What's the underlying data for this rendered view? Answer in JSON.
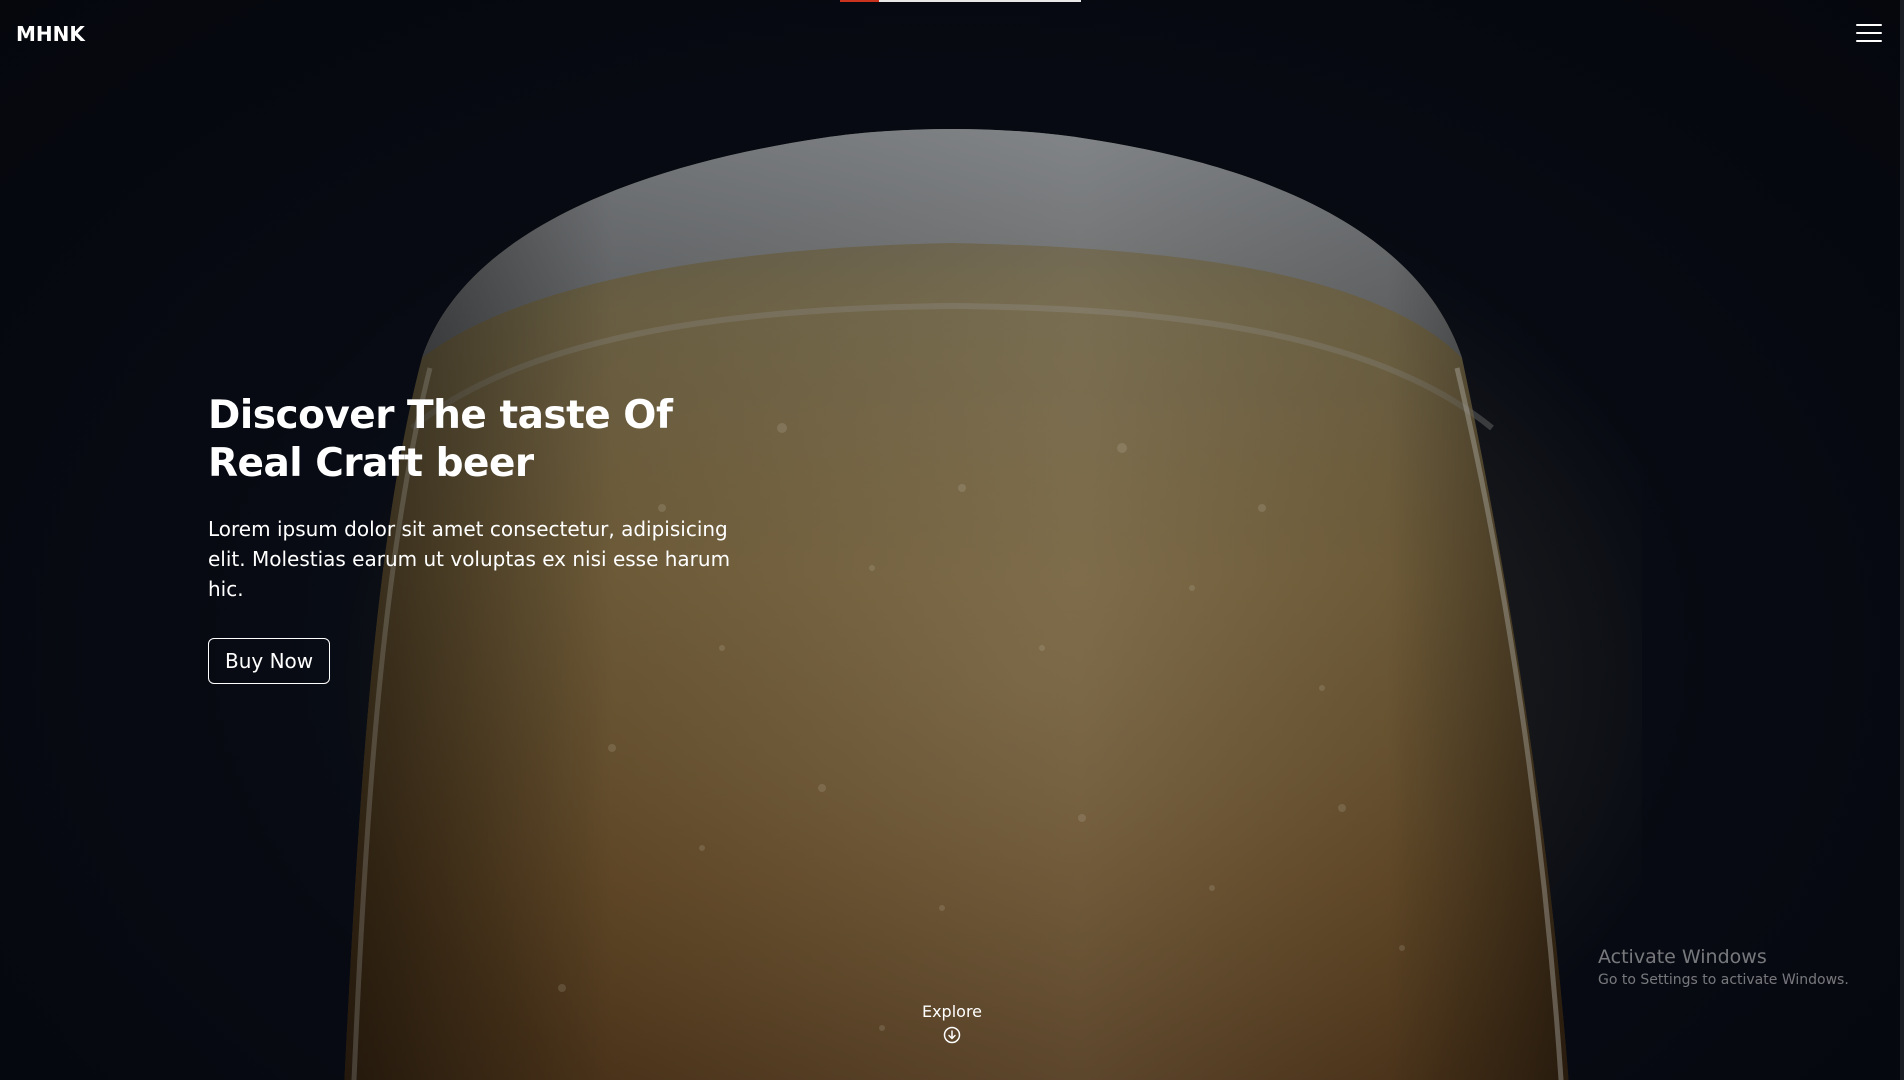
{
  "brand": {
    "logo_text": "MHNK"
  },
  "nav": {
    "menu_icon": "hamburger-menu-icon"
  },
  "top_progress": {
    "progress_fraction": 0.16,
    "track_color": "#e8e8e8",
    "fill_color": "#c9321c"
  },
  "hero": {
    "title_line1": "Discover The taste Of",
    "title_line2": "Real Craft beer",
    "text": "Lorem ipsum dolor sit amet consectetur, adipisicing elit. Molestias earum ut voluptas ex nisi esse harum hic.",
    "cta_label": "Buy Now",
    "background_image": "glass-of-beer"
  },
  "explore": {
    "label": "Explore",
    "icon": "arrow-down-circle-icon"
  },
  "watermark": {
    "title": "Activate Windows",
    "subtitle": "Go to Settings to activate Windows."
  },
  "colors": {
    "background": "#070a12",
    "text": "#ffffff"
  }
}
